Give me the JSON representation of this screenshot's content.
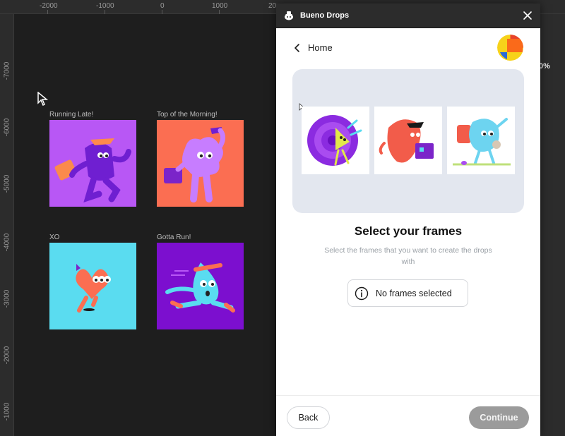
{
  "ruler": {
    "top_ticks": [
      "-2000",
      "-1000",
      "0",
      "1000",
      "20"
    ],
    "left_ticks": [
      "-7000",
      "-6000",
      "-5000",
      "-4000",
      "-3000",
      "-2000",
      "-1000"
    ]
  },
  "canvas": {
    "frames": [
      {
        "title": "Running Late!",
        "bg": "#b857f5"
      },
      {
        "title": "Top of the Morning!",
        "bg": "#fb6e52"
      },
      {
        "title": "XO",
        "bg": "#5adcf0"
      },
      {
        "title": "Gotta Run!",
        "bg": "#7c0fcf"
      }
    ],
    "zoom_fragment": "0%"
  },
  "panel": {
    "title": "Bueno Drops",
    "nav": {
      "back_label": "Home"
    },
    "heading": "Select your frames",
    "subtext": "Select the frames that you want to create the drops with",
    "status": "No frames selected",
    "footer": {
      "back_label": "Back",
      "continue_label": "Continue"
    }
  },
  "colors": {
    "canvas_bg": "#1e1e1e",
    "panel_bg": "#ffffff",
    "preview_bg": "#e3e7ef",
    "continue_disabled": "#9b9b9b"
  }
}
